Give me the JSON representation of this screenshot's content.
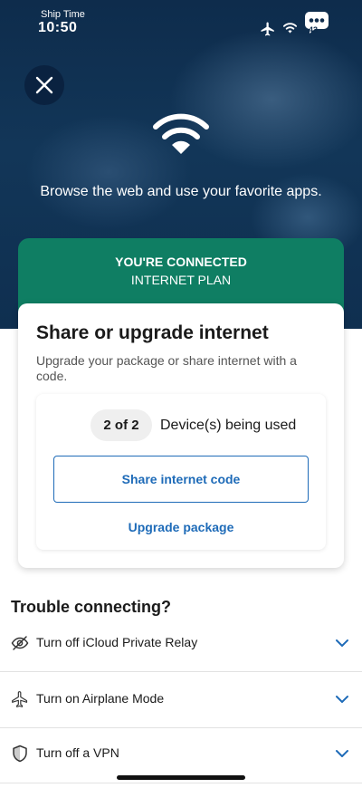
{
  "status_bar": {
    "app_name": "Ship Time",
    "time": "10:50",
    "battery": "43"
  },
  "hero": {
    "tagline": "Browse the web and use your favorite apps."
  },
  "connection": {
    "status": "YOU'RE CONNECTED",
    "plan": "INTERNET PLAN"
  },
  "card": {
    "title": "Share or upgrade internet",
    "subtitle": "Upgrade your package or share internet with a code.",
    "device_count": "2 of 2",
    "device_label": "Device(s) being used",
    "share_label": "Share internet code",
    "upgrade_label": "Upgrade package"
  },
  "trouble": {
    "title": "Trouble connecting?",
    "items": [
      {
        "label": "Turn off iCloud Private Relay",
        "icon": "eye-slash-icon"
      },
      {
        "label": "Turn on Airplane Mode",
        "icon": "airplane-icon"
      },
      {
        "label": "Turn off a VPN",
        "icon": "shield-icon"
      }
    ]
  },
  "colors": {
    "hero_bg": "#0e2c4c",
    "connected_green": "#0f7e63",
    "link_blue": "#1e6bb8"
  }
}
